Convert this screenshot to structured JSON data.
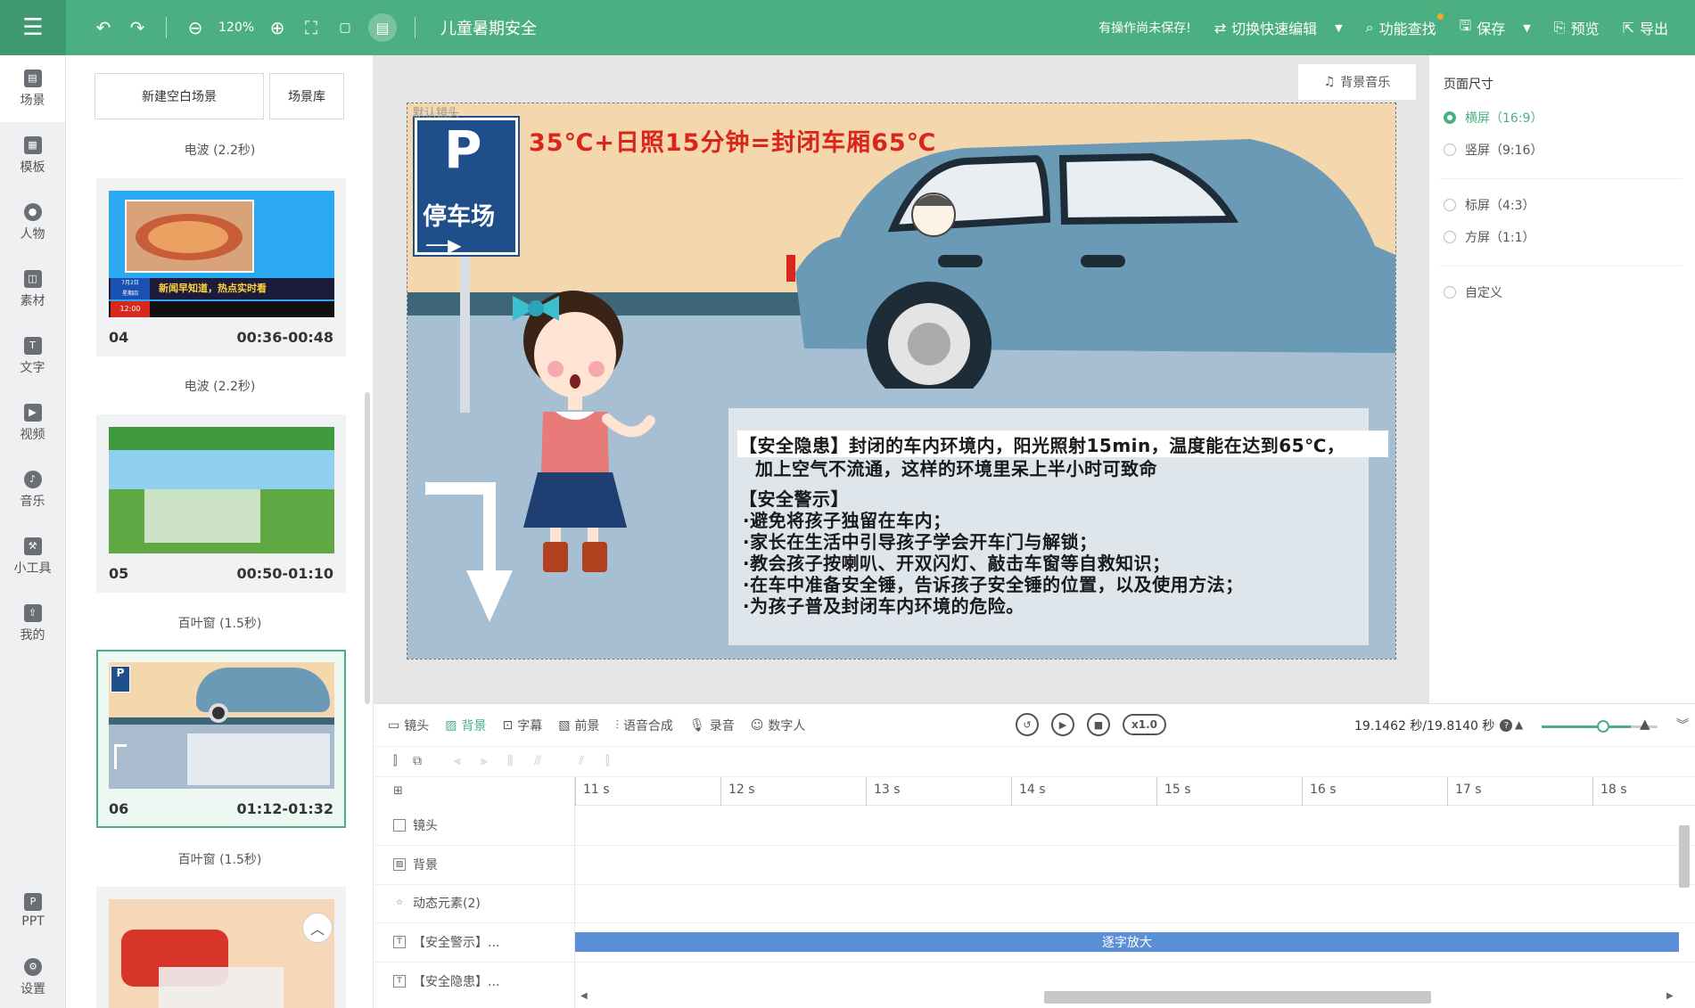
{
  "topbar": {
    "zoom": "120%",
    "doc_title": "儿童暑期安全",
    "unsaved": "有操作尚未保存!",
    "quick_edit": "切换快速编辑",
    "find": "功能查找",
    "save": "保存",
    "preview": "预览",
    "export": "导出"
  },
  "nav": {
    "items": [
      {
        "label": "场景",
        "icon": "scene-icon"
      },
      {
        "label": "模板",
        "icon": "template-icon"
      },
      {
        "label": "人物",
        "icon": "person-icon"
      },
      {
        "label": "素材",
        "icon": "material-icon"
      },
      {
        "label": "文字",
        "icon": "text-icon"
      },
      {
        "label": "视频",
        "icon": "video-icon"
      },
      {
        "label": "音乐",
        "icon": "music-icon"
      },
      {
        "label": "小工具",
        "icon": "toolbox-icon"
      },
      {
        "label": "我的",
        "icon": "upload-icon"
      }
    ],
    "bottom": [
      {
        "label": "PPT",
        "icon": "ppt-icon"
      },
      {
        "label": "设置",
        "icon": "gear-icon"
      }
    ]
  },
  "scenes": {
    "new_blank": "新建空白场景",
    "library": "场景库",
    "transitions": [
      "电波 (2.2秒)",
      "电波 (2.2秒)",
      "百叶窗 (1.5秒)",
      "百叶窗 (1.5秒)"
    ],
    "cards": [
      {
        "num": "04",
        "time": "00:36-00:48"
      },
      {
        "num": "05",
        "time": "00:50-01:10"
      },
      {
        "num": "06",
        "time": "01:12-01:32"
      }
    ],
    "thumb04_caption": "新闻早知道，热点实时看",
    "thumb04_date": "7月2日",
    "thumb04_weekday": "星期四",
    "thumb04_clock": "12:00"
  },
  "canvas": {
    "bgm": "背景音乐",
    "camera_label": "默认镜头",
    "title": "35℃+日照15分钟=封闭车厢65℃",
    "parking_text": "停车场",
    "parking_p": "P",
    "lines": [
      "【安全隐患】封闭的车内环境内，阳光照射15min，温度能在达到65℃，",
      "加上空气不流通，这样的环境里呆上半小时可致命",
      "【安全警示】",
      "·避免将孩子独留在车内；",
      "·家长在生活中引导孩子学会开车门与解锁；",
      "·教会孩子按喇叭、开双闪灯、敲击车窗等自救知识；",
      "·在车中准备安全锤，告诉孩子安全锤的位置，以及使用方法；",
      "·为孩子普及封闭车内环境的危险。"
    ]
  },
  "props": {
    "title": "页面尺寸",
    "options": [
      {
        "label": "横屏（16:9）",
        "checked": true
      },
      {
        "label": "竖屏（9:16）",
        "checked": false
      },
      {
        "label": "标屏（4:3）",
        "checked": false
      },
      {
        "label": "方屏（1:1）",
        "checked": false
      },
      {
        "label": "自定义",
        "checked": false
      }
    ]
  },
  "timeline": {
    "tabs": [
      {
        "label": "镜头",
        "active": false
      },
      {
        "label": "背景",
        "active": true
      },
      {
        "label": "字幕",
        "active": false
      },
      {
        "label": "前景",
        "active": false
      },
      {
        "label": "语音合成",
        "active": false
      },
      {
        "label": "录音",
        "active": false
      },
      {
        "label": "数字人",
        "active": false
      }
    ],
    "speed": "x1.0",
    "time": "19.1462 秒/19.8140 秒",
    "ticks": [
      "11 s",
      "12 s",
      "13 s",
      "14 s",
      "15 s",
      "16 s",
      "17 s",
      "18 s"
    ],
    "tracks": [
      "镜头",
      "背景",
      "动态元素(2)",
      "【安全警示】...",
      "【安全隐患】..."
    ],
    "clip_label": "逐字放大"
  },
  "colors": {
    "accent": "#4caf82",
    "title_red": "#d9261c",
    "clip_blue": "#5b8fd6"
  }
}
